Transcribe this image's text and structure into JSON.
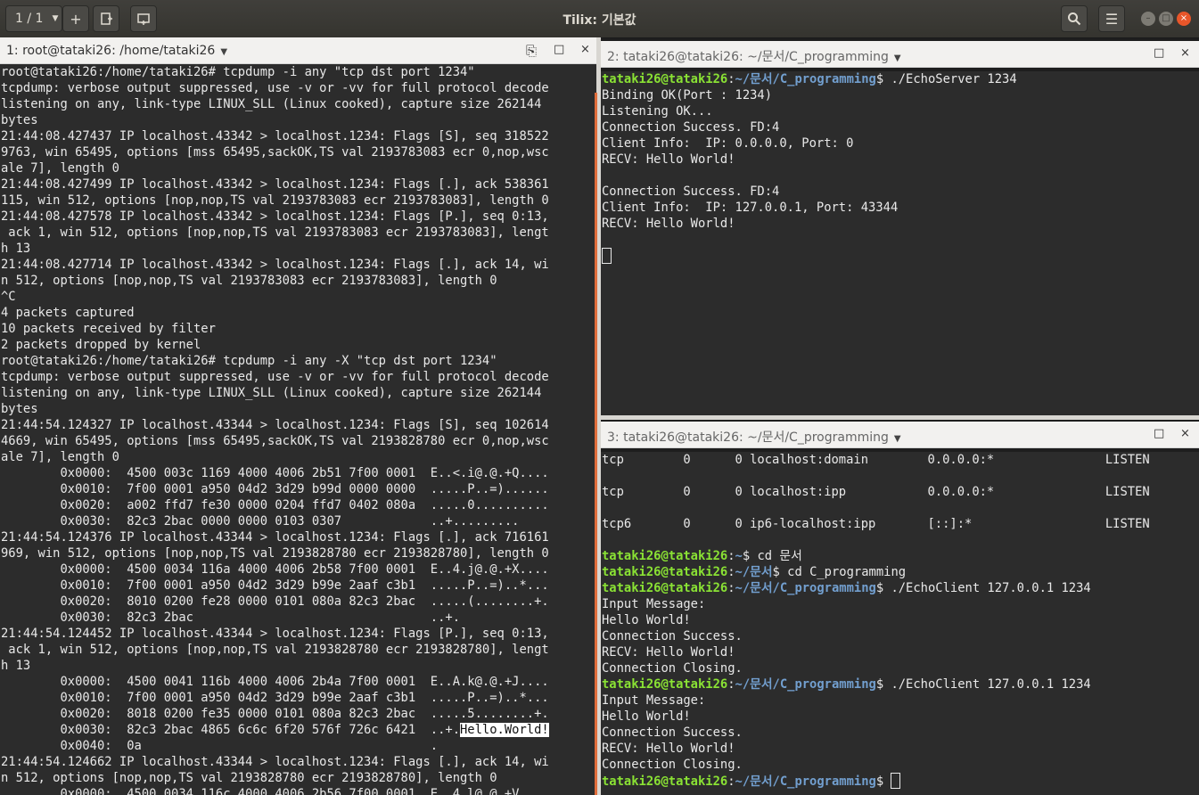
{
  "header": {
    "session_label": "1 / 1",
    "title": "Tilix: 기본값"
  },
  "panes": [
    {
      "title": "1: root@tataki26: /home/tataki26",
      "lines": [
        "root@tataki26:/home/tataki26# tcpdump -i any \"tcp dst port 1234\"",
        "tcpdump: verbose output suppressed, use -v or -vv for full protocol decode",
        "listening on any, link-type LINUX_SLL (Linux cooked), capture size 262144",
        "bytes",
        "21:44:08.427437 IP localhost.43342 > localhost.1234: Flags [S], seq 318522",
        "9763, win 65495, options [mss 65495,sackOK,TS val 2193783083 ecr 0,nop,wsc",
        "ale 7], length 0",
        "21:44:08.427499 IP localhost.43342 > localhost.1234: Flags [.], ack 538361",
        "115, win 512, options [nop,nop,TS val 2193783083 ecr 2193783083], length 0",
        "21:44:08.427578 IP localhost.43342 > localhost.1234: Flags [P.], seq 0:13,",
        " ack 1, win 512, options [nop,nop,TS val 2193783083 ecr 2193783083], lengt",
        "h 13",
        "21:44:08.427714 IP localhost.43342 > localhost.1234: Flags [.], ack 14, wi",
        "n 512, options [nop,nop,TS val 2193783083 ecr 2193783083], length 0",
        "^C",
        "4 packets captured",
        "10 packets received by filter",
        "2 packets dropped by kernel",
        "root@tataki26:/home/tataki26# tcpdump -i any -X \"tcp dst port 1234\"",
        "tcpdump: verbose output suppressed, use -v or -vv for full protocol decode",
        "listening on any, link-type LINUX_SLL (Linux cooked), capture size 262144",
        "bytes",
        "21:44:54.124327 IP localhost.43344 > localhost.1234: Flags [S], seq 102614",
        "4669, win 65495, options [mss 65495,sackOK,TS val 2193828780 ecr 0,nop,wsc",
        "ale 7], length 0",
        "        0x0000:  4500 003c 1169 4000 4006 2b51 7f00 0001  E..<.i@.@.+Q....",
        "        0x0010:  7f00 0001 a950 04d2 3d29 b99d 0000 0000  .....P..=)......",
        "        0x0020:  a002 ffd7 fe30 0000 0204 ffd7 0402 080a  .....0..........",
        "        0x0030:  82c3 2bac 0000 0000 0103 0307            ..+.........",
        "21:44:54.124376 IP localhost.43344 > localhost.1234: Flags [.], ack 716161",
        "969, win 512, options [nop,nop,TS val 2193828780 ecr 2193828780], length 0",
        "        0x0000:  4500 0034 116a 4000 4006 2b58 7f00 0001  E..4.j@.@.+X....",
        "        0x0010:  7f00 0001 a950 04d2 3d29 b99e 2aaf c3b1  .....P..=)..*...",
        "        0x0020:  8010 0200 fe28 0000 0101 080a 82c3 2bac  .....(........+.",
        "        0x0030:  82c3 2bac                                ..+.",
        "21:44:54.124452 IP localhost.43344 > localhost.1234: Flags [P.], seq 0:13,",
        " ack 1, win 512, options [nop,nop,TS val 2193828780 ecr 2193828780], lengt",
        "h 13",
        "        0x0000:  4500 0041 116b 4000 4006 2b4a 7f00 0001  E..A.k@.@.+J....",
        "        0x0010:  7f00 0001 a950 04d2 3d29 b99e 2aaf c3b1  .....P..=)..*...",
        "        0x0020:  8018 0200 fe35 0000 0101 080a 82c3 2bac  .....5........+.",
        "        0x0030:  82c3 2bac 4865 6c6c 6f20 576f 726c 6421  ..+.",
        "        0x0040:  0a                                       .",
        "21:44:54.124662 IP localhost.43344 > localhost.1234: Flags [.], ack 14, wi",
        "n 512, options [nop,nop,TS val 2193828780 ecr 2193828780], length 0",
        "        0x0000:  4500 0034 116c 4000 4006 2b56 7f00 0001  E..4.l@.@.+V...."
      ],
      "highlight_text": "Hello.World!"
    },
    {
      "title": "2: tataki26@tataki26: ~/문서/C_programming",
      "prompt_user": "tataki26@tataki26",
      "prompt_path": "~/문서/C_programming",
      "command": " ./EchoServer 1234",
      "lines": [
        "Binding OK(Port : 1234)",
        "Listening OK...",
        "Connection Success. FD:4",
        "Client Info:  IP: 0.0.0.0, Port: 0",
        "RECV: Hello World!",
        "",
        "Connection Success. FD:4",
        "Client Info:  IP: 127.0.0.1, Port: 43344",
        "RECV: Hello World!",
        ""
      ]
    },
    {
      "title": "3: tataki26@tataki26: ~/문서/C_programming",
      "netstat": [
        "tcp        0      0 localhost:domain        0.0.0.0:*               LISTEN",
        "",
        "tcp        0      0 localhost:ipp           0.0.0.0:*               LISTEN",
        "",
        "tcp6       0      0 ip6-localhost:ipp       [::]:*                  LISTEN",
        ""
      ],
      "session": [
        {
          "type": "prompt",
          "path": "~",
          "cmd": " cd 문서"
        },
        {
          "type": "prompt",
          "path": "~/문서",
          "cmd": " cd C_programming"
        },
        {
          "type": "prompt",
          "path": "~/문서/C_programming",
          "cmd": " ./EchoClient 127.0.0.1 1234"
        },
        {
          "type": "out",
          "text": "Input Message:"
        },
        {
          "type": "out",
          "text": "Hello World!"
        },
        {
          "type": "out",
          "text": "Connection Success."
        },
        {
          "type": "out",
          "text": "RECV: Hello World!"
        },
        {
          "type": "out",
          "text": "Connection Closing."
        },
        {
          "type": "prompt",
          "path": "~/문서/C_programming",
          "cmd": " ./EchoClient 127.0.0.1 1234"
        },
        {
          "type": "out",
          "text": "Input Message:"
        },
        {
          "type": "out",
          "text": "Hello World!"
        },
        {
          "type": "out",
          "text": "Connection Success."
        },
        {
          "type": "out",
          "text": "RECV: Hello World!"
        },
        {
          "type": "out",
          "text": "Connection Closing."
        },
        {
          "type": "prompt",
          "path": "~/문서/C_programming",
          "cmd": "",
          "cursor": true
        }
      ],
      "prompt_user": "tataki26@tataki26"
    }
  ]
}
